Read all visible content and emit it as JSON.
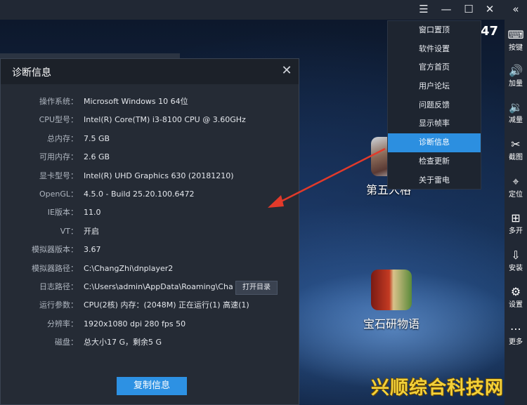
{
  "titlebar": {
    "menu_icon": "hamburger-icon",
    "minimize_icon": "minimize-icon",
    "maximize_icon": "maximize-icon",
    "close_icon": "close-icon",
    "clock_partial": "47"
  },
  "menu": {
    "items": [
      {
        "label": "窗口置顶"
      },
      {
        "label": "软件设置"
      },
      {
        "label": "官方首页"
      },
      {
        "label": "用户论坛"
      },
      {
        "label": "问题反馈"
      },
      {
        "label": "显示帧率"
      },
      {
        "label": "诊断信息",
        "active": true
      },
      {
        "label": "检查更新"
      },
      {
        "label": "关于雷电"
      }
    ]
  },
  "toolbar": {
    "items": [
      {
        "label": "按键",
        "icon": "keyboard-icon"
      },
      {
        "label": "加量",
        "icon": "volume-up-icon"
      },
      {
        "label": "减量",
        "icon": "volume-down-icon"
      },
      {
        "label": "截图",
        "icon": "scissors-icon"
      },
      {
        "label": "定位",
        "icon": "location-pin-icon"
      },
      {
        "label": "多开",
        "icon": "multi-instance-icon"
      },
      {
        "label": "安装",
        "icon": "apk-install-icon"
      },
      {
        "label": "设置",
        "icon": "gear-icon"
      },
      {
        "label": "更多",
        "icon": "more-icon"
      }
    ]
  },
  "desktop": {
    "apps": [
      {
        "name": "第五人格"
      },
      {
        "name": "宝石研物语"
      }
    ]
  },
  "dialog": {
    "title": "诊断信息",
    "rows": [
      {
        "label": "操作系统：",
        "value": "Microsoft Windows 10 64位"
      },
      {
        "label": "CPU型号：",
        "value": "Intel(R) Core(TM) i3-8100 CPU @ 3.60GHz"
      },
      {
        "label": "总内存：",
        "value": "7.5 GB"
      },
      {
        "label": "可用内存：",
        "value": "2.6 GB"
      },
      {
        "label": "显卡型号：",
        "value": "Intel(R) UHD Graphics 630 (20181210)"
      },
      {
        "label": "OpenGL：",
        "value": "4.5.0 - Build 25.20.100.6472"
      },
      {
        "label": "IE版本：",
        "value": "11.0"
      },
      {
        "label": "VT：",
        "value": "开启"
      },
      {
        "label": "模拟器版本：",
        "value": "3.67"
      },
      {
        "label": "模拟器路径：",
        "value": "C:\\ChangZhi\\dnplayer2"
      },
      {
        "label": "日志路径：",
        "value": "C:\\Users\\admin\\AppData\\Roaming\\Cha..."
      },
      {
        "label": "运行参数：",
        "value": "CPU(2核) 内存：(2048M) 正在运行(1) 高速(1)"
      },
      {
        "label": "分辨率：",
        "value": "1920x1080 dpi 280 fps 50"
      },
      {
        "label": "磁盘：",
        "value": "总大小17 G，剩余5 G"
      }
    ],
    "open_dir_label": "打开目录",
    "copy_label": "复制信息"
  },
  "watermark": "兴顺综合科技网",
  "colors": {
    "accent": "#2c8fe0",
    "annotation_arrow": "#e23a2a"
  }
}
